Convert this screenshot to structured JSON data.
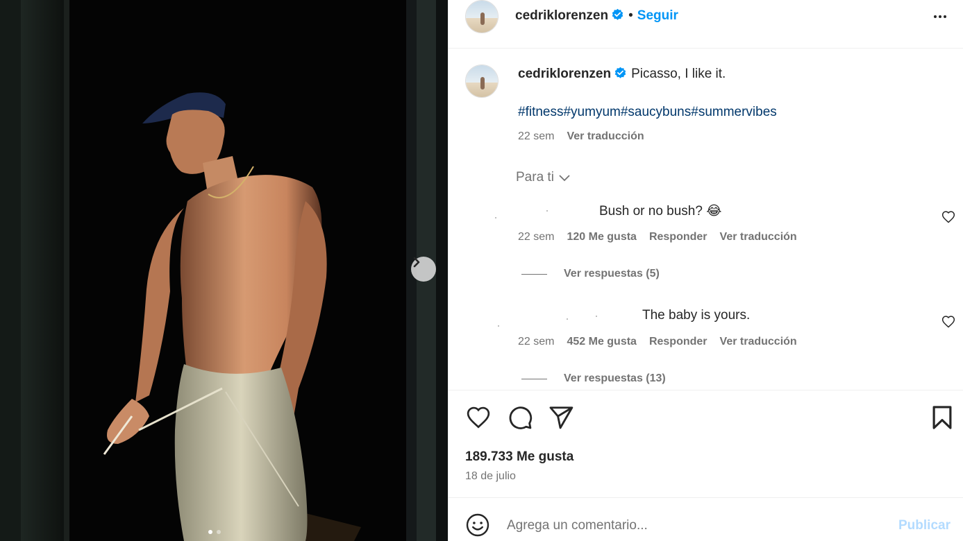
{
  "post": {
    "photo": {
      "description_icon": "photo-carousel",
      "carousel_total": 2,
      "carousel_active": 1
    },
    "header": {
      "username": "cedriklorenzen",
      "separator": "•",
      "follow_label": "Seguir"
    },
    "caption": {
      "username": "cedriklorenzen",
      "text": "Picasso, I like it.",
      "hashtags": [
        "#fitness",
        "#yumyum",
        "#saucybuns",
        "#summervibes"
      ],
      "time": "22 sem",
      "translate": "Ver traducción"
    },
    "sort_label": "Para ti",
    "comments": [
      {
        "text": "Bush or no bush? 😂",
        "time": "22 sem",
        "likes": "120 Me gusta",
        "reply": "Responder",
        "translate": "Ver traducción",
        "view_replies": "Ver respuestas (5)"
      },
      {
        "text": "The baby is yours.",
        "time": "22 sem",
        "likes": "452 Me gusta",
        "reply": "Responder",
        "translate": "Ver traducción",
        "view_replies": "Ver respuestas (13)"
      }
    ],
    "likes_count": "189.733 Me gusta",
    "date": "18 de julio",
    "add_comment": {
      "placeholder": "Agrega un comentario...",
      "publish_label": "Publicar"
    }
  },
  "colors": {
    "link_blue": "#0095f6",
    "hashtag_blue": "#00376b",
    "muted": "#737373",
    "publish_disabled": "#b3dbff",
    "verified_blue": "#0095f6"
  }
}
